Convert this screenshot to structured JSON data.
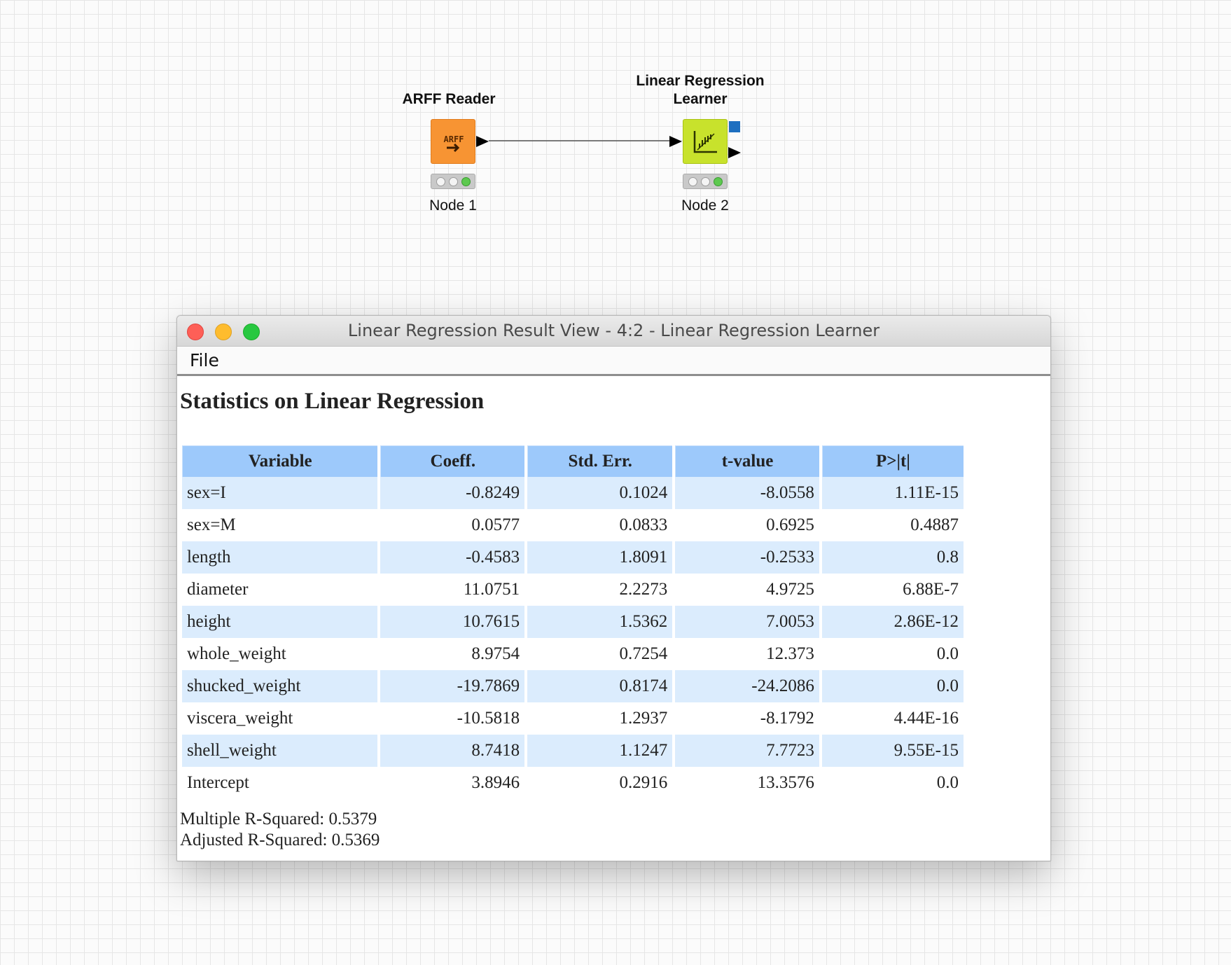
{
  "canvas": {
    "node1": {
      "title": "ARFF Reader",
      "icon_text": "ARFF",
      "label": "Node 1",
      "icon": "arff-reader-icon",
      "color": "#f79433"
    },
    "node2": {
      "title_line1": "Linear Regression",
      "title_line2": "Learner",
      "label": "Node 2",
      "icon": "linear-regression-icon",
      "color": "#c8e22c"
    }
  },
  "window": {
    "title": "Linear Regression Result View - 4:2 - Linear Regression Learner",
    "menu": {
      "file": "File"
    },
    "heading": "Statistics on Linear Regression",
    "table": {
      "headers": [
        "Variable",
        "Coeff.",
        "Std. Err.",
        "t-value",
        "P>|t|"
      ],
      "rows": [
        [
          "sex=I",
          "-0.8249",
          "0.1024",
          "-8.0558",
          "1.11E-15"
        ],
        [
          "sex=M",
          "0.0577",
          "0.0833",
          "0.6925",
          "0.4887"
        ],
        [
          "length",
          "-0.4583",
          "1.8091",
          "-0.2533",
          "0.8"
        ],
        [
          "diameter",
          "11.0751",
          "2.2273",
          "4.9725",
          "6.88E-7"
        ],
        [
          "height",
          "10.7615",
          "1.5362",
          "7.0053",
          "2.86E-12"
        ],
        [
          "whole_weight",
          "8.9754",
          "0.7254",
          "12.373",
          "0.0"
        ],
        [
          "shucked_weight",
          "-19.7869",
          "0.8174",
          "-24.2086",
          "0.0"
        ],
        [
          "viscera_weight",
          "-10.5818",
          "1.2937",
          "-8.1792",
          "4.44E-16"
        ],
        [
          "shell_weight",
          "8.7418",
          "1.1247",
          "7.7723",
          "9.55E-15"
        ],
        [
          "Intercept",
          "3.8946",
          "0.2916",
          "13.3576",
          "0.0"
        ]
      ]
    },
    "multiple_r_squared": "Multiple R-Squared: 0.5379",
    "adjusted_r_squared": "Adjusted R-Squared: 0.5369"
  }
}
